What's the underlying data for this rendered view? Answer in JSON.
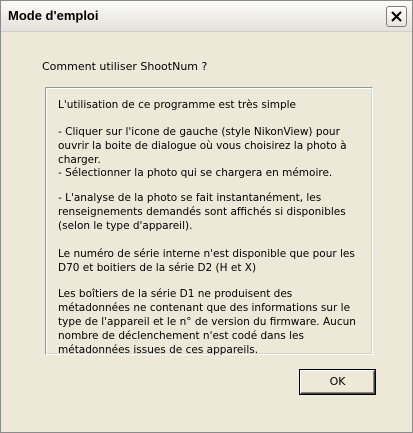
{
  "window": {
    "title": "Mode d'emploi"
  },
  "dialog": {
    "prompt": "Comment utiliser ShootNum ?",
    "paragraphs": [
      "L'utilisation de ce programme est très simple",
      "- Cliquer sur l'icone de gauche (style NikonView) pour ouvrir la boite de dialogue où vous choisirez la photo à charger.",
      "- Sélectionner la photo qui se chargera en mémoire.",
      " - L'analyse de la photo se fait instantanément, les renseignements demandés sont affichés si disponibles (selon le type d'appareil).",
      "Le numéro de série interne n'est disponible que pour les D70 et boitiers de la série D2 (H et X)",
      "Les boîtiers de la série D1 ne produisent des métadonnées ne contenant que des informations sur le type de l'appareil et le n° de version du firmware. Aucun nombre de déclenchement n'est codé dans les métadonnées issues de ces appareils."
    ],
    "ok_label": "OK"
  },
  "icons": {
    "close": "close-icon"
  }
}
